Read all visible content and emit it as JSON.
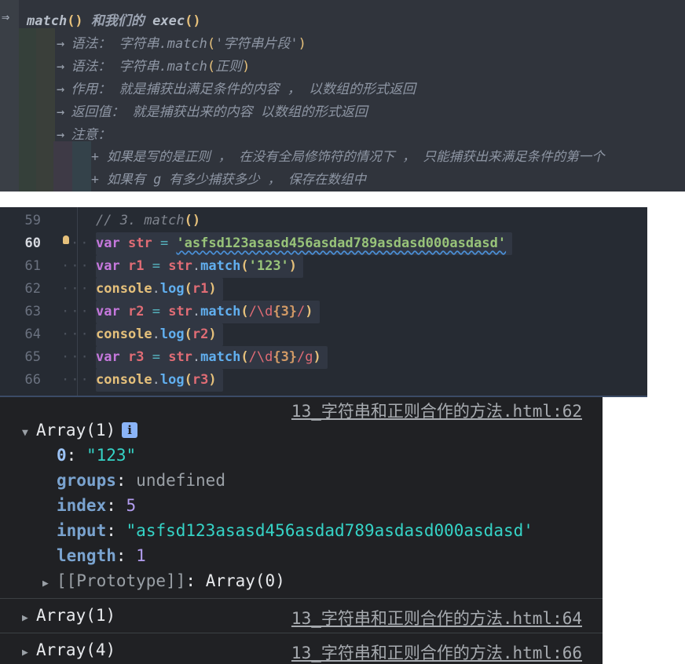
{
  "notes": {
    "header": {
      "arrow": "⇒",
      "fn": "match",
      "text": "和我们的",
      "fn2": "exec"
    },
    "lines": [
      {
        "arrow": "→",
        "text": "语法： 字符串.match",
        "arg": "'字符串片段'"
      },
      {
        "arrow": "→",
        "text": "语法： 字符串.match",
        "arg": "正则"
      },
      {
        "arrow": "→",
        "text": "作用： 就是捕获出满足条件的内容 ， 以数组的形式返回"
      },
      {
        "arrow": "→",
        "text": "返回值： 就是捕获出来的内容 以数组的形式返回"
      },
      {
        "arrow": "→",
        "text": "注意："
      }
    ],
    "sub_lines": [
      "+ 如果是写的是正则 ， 在没有全局修饰符的情况下 ， 只能捕获出来满足条件的第一个",
      "+ 如果有 g 有多少捕获多少 ， 保存在数组中"
    ]
  },
  "editor": {
    "lines": [
      {
        "no": "59",
        "comment": "// 3. match",
        "parens": "()"
      },
      {
        "no": "60",
        "kw": "var",
        "name": "str",
        "eq": "=",
        "str": "'asfsd123asasd456asdad789asdasd000asdasd'"
      },
      {
        "no": "61",
        "kw": "var",
        "name": "r1",
        "eq": "=",
        "obj": "str",
        "dot": ".",
        "meth": "match",
        "open": "(",
        "arg": "'123'",
        "close": ")"
      },
      {
        "no": "62",
        "obj": "console",
        "dot": ".",
        "meth": "log",
        "open": "(",
        "arg": "r1",
        "close": ")"
      },
      {
        "no": "63",
        "kw": "var",
        "name": "r2",
        "eq": "=",
        "obj": "str",
        "dot": ".",
        "meth": "match",
        "open": "(",
        "rx1": "/\\d",
        "rxq": "{3}",
        "rx2": "/",
        "close": ")"
      },
      {
        "no": "64",
        "obj": "console",
        "dot": ".",
        "meth": "log",
        "open": "(",
        "arg": "r2",
        "close": ")"
      },
      {
        "no": "65",
        "kw": "var",
        "name": "r3",
        "eq": "=",
        "obj": "str",
        "dot": ".",
        "meth": "match",
        "open": "(",
        "rx1": "/\\d",
        "rxq": "{3}",
        "rx2": "/g",
        "close": ")"
      },
      {
        "no": "66",
        "obj": "console",
        "dot": ".",
        "meth": "log",
        "open": "(",
        "arg": "r3",
        "close": ")"
      }
    ],
    "active_line": "60"
  },
  "console": {
    "entry1": {
      "source": "13_字符串和正则合作的方法.html:62",
      "label": "Array(1)",
      "props": [
        {
          "key": "0",
          "colon": ":",
          "value": "\"123\""
        },
        {
          "key": "groups",
          "colon": ":",
          "value": "undefined"
        },
        {
          "key": "index",
          "colon": ":",
          "value": "5"
        },
        {
          "key": "input",
          "colon": ":",
          "value": "\"asfsd123asasd456asdad789asdasd000asdasd'"
        },
        {
          "key": "length",
          "colon": ":",
          "value": "1"
        }
      ],
      "proto_key": "[[Prototype]]",
      "proto_colon": ":",
      "proto_value": "Array(0)"
    },
    "entry2": {
      "label": "Array(1)",
      "source": "13_字符串和正则合作的方法.html:64"
    },
    "entry3": {
      "label": "Array(4)",
      "source": "13_字符串和正则合作的方法.html:66"
    }
  }
}
